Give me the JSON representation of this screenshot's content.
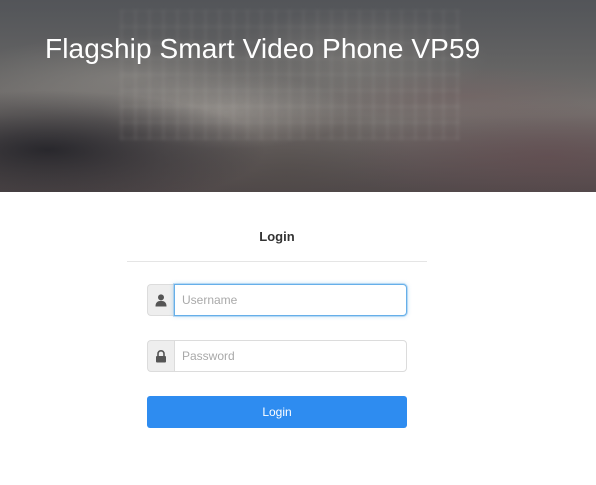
{
  "header": {
    "title": "Flagship Smart Video Phone VP59"
  },
  "login": {
    "heading": "Login",
    "username": {
      "value": "",
      "placeholder": "Username",
      "icon": "user-icon"
    },
    "password": {
      "value": "",
      "placeholder": "Password",
      "icon": "lock-icon"
    },
    "submit_label": "Login"
  },
  "colors": {
    "accent": "#2e8cf0",
    "focus_border": "#66afe9",
    "icon": "#555555"
  }
}
